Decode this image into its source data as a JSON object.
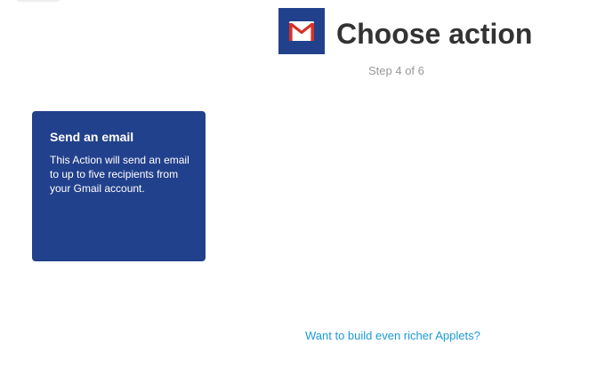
{
  "header": {
    "service_logo_icon": "gmail-envelope-icon",
    "title": "Choose action",
    "step": "Step 4 of 6"
  },
  "actions": [
    {
      "title": "Send an email",
      "description": "This Action will send an email to up to five recipients from your Gmail account."
    }
  ],
  "footer": {
    "link_text": "Want to build even richer Applets?"
  },
  "colors": {
    "brand_blue": "#22418c",
    "link_blue": "#1b9ad6",
    "gmail_red": "#d93025",
    "title_text": "#333333",
    "muted_text": "#999999"
  }
}
